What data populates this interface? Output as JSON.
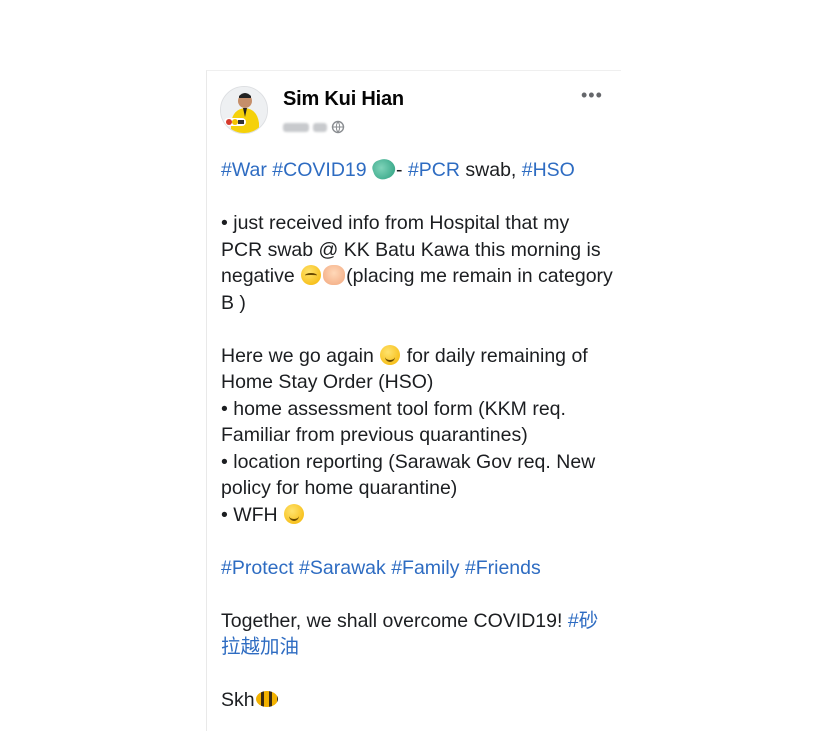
{
  "post": {
    "author": "Sim Kui Hian",
    "more_label": "•••",
    "lines": {
      "l1_t1": "#War",
      "l1_t2": "#COVID19",
      "l1_dash": "- ",
      "l1_t3": "#PCR",
      "l1_mid": " swab, ",
      "l1_t4": "#HSO",
      "p2_a": "• just received info from Hospital that my PCR swab @ KK Batu Kawa this morning is negative ",
      "p2_b": "(placing me remain in category B )",
      "p3_a": "Here we go again ",
      "p3_b": " for daily remaining of Home Stay Order (HSO)",
      "p4": "• home assessment tool form (KKM req. Familiar from previous quarantines)",
      "p5": "• location reporting (Sarawak Gov req. New policy for home quarantine)",
      "p6": "• WFH ",
      "h1": "#Protect",
      "h2": "#Sarawak",
      "h3": "#Family",
      "h4": "#Friends",
      "p7": "Together, we shall overcome COVID19!  ",
      "p7_tag": "#砂拉越加油",
      "sign": "Skh"
    }
  },
  "colors": {
    "hashtag": "#2e6cc2",
    "text": "#1c1e21"
  },
  "icons": {
    "virus": "microbe-emoji",
    "sad": "downcast-face-emoji",
    "hands": "palms-up-emoji",
    "relieved": "relieved-face-emoji",
    "wink": "winking-face-emoji",
    "bee": "bee-emoji",
    "privacy": "globe-icon"
  }
}
